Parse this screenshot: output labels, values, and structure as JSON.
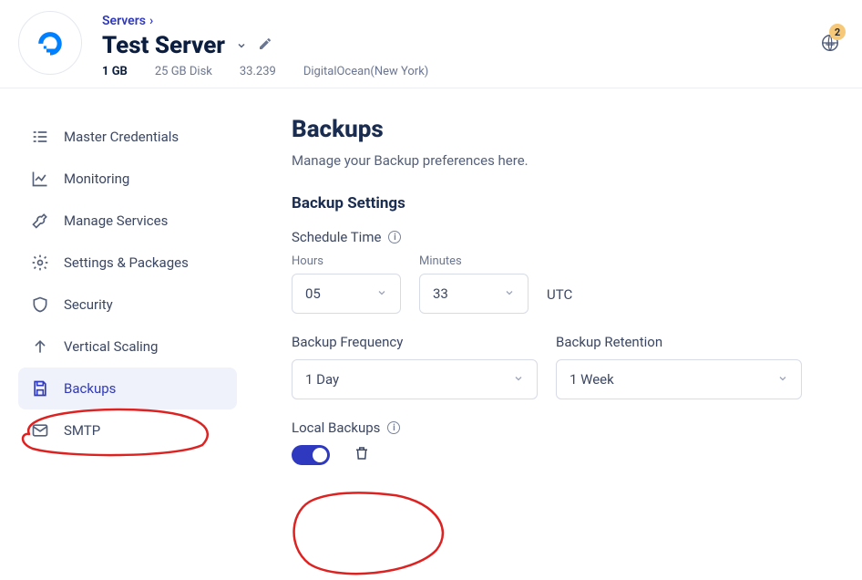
{
  "breadcrumb": {
    "label": "Servers",
    "chevron": "›"
  },
  "server": {
    "name": "Test Server",
    "ram": "1 GB",
    "disk": "25 GB Disk",
    "ip": "33.239",
    "provider": "DigitalOcean(New York)"
  },
  "notif": {
    "count": "2"
  },
  "sidebar": {
    "items": [
      {
        "label": "Master Credentials"
      },
      {
        "label": "Monitoring"
      },
      {
        "label": "Manage Services"
      },
      {
        "label": "Settings & Packages"
      },
      {
        "label": "Security"
      },
      {
        "label": "Vertical Scaling"
      },
      {
        "label": "Backups"
      },
      {
        "label": "SMTP"
      }
    ]
  },
  "page": {
    "title": "Backups",
    "subtitle": "Manage your Backup preferences here.",
    "section_settings": "Backup Settings",
    "schedule_label": "Schedule Time",
    "hours_label": "Hours",
    "minutes_label": "Minutes",
    "hours_value": "05",
    "minutes_value": "33",
    "tz": "UTC",
    "freq_label": "Backup Frequency",
    "freq_value": "1 Day",
    "ret_label": "Backup Retention",
    "ret_value": "1 Week",
    "local_label": "Local Backups"
  }
}
